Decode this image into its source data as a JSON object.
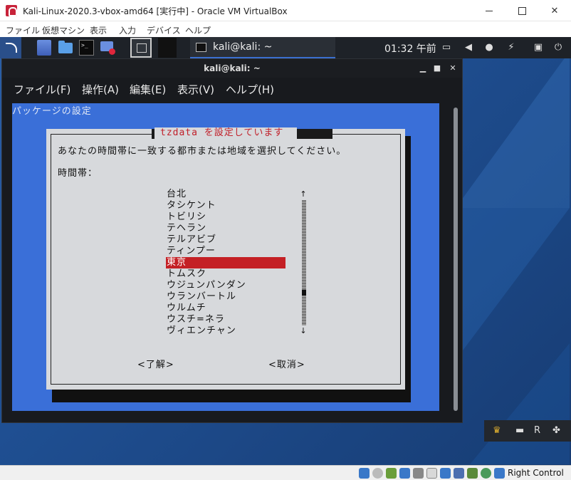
{
  "window": {
    "title": "Kali-Linux-2020.3-vbox-amd64 [実行中] - Oracle VM VirtualBox"
  },
  "vb_menu": [
    "ファイル",
    "仮想マシン",
    "表示",
    "入力",
    "デバイス",
    "ヘルプ"
  ],
  "panel": {
    "task_label": "kali@kali: ~",
    "clock": "01:32 午前"
  },
  "terminal": {
    "title": "kali@kali: ~",
    "menu": [
      "ファイル(F)",
      "操作(A)",
      "編集(E)",
      "表示(V)",
      "ヘルプ(H)"
    ]
  },
  "background_title": "パッケージの設定",
  "dialog": {
    "title": "tzdata を設定しています",
    "prompt": "あなたの時間帯に一致する都市または地域を選択してください。",
    "label": "時間帯：",
    "items": [
      "台北",
      "タシケント",
      "トビリシ",
      "テヘラン",
      "テルアビブ",
      "ティンプー",
      "東京",
      "トムスク",
      "ウジュンパンダン",
      "ウランバートル",
      "ウルムチ",
      "ウスチ=ネラ",
      "ヴィエンチャン"
    ],
    "selected_index": 6,
    "ok_label": "<了解>",
    "cancel_label": "<取消>"
  },
  "status": {
    "host_key": "Right Control"
  }
}
